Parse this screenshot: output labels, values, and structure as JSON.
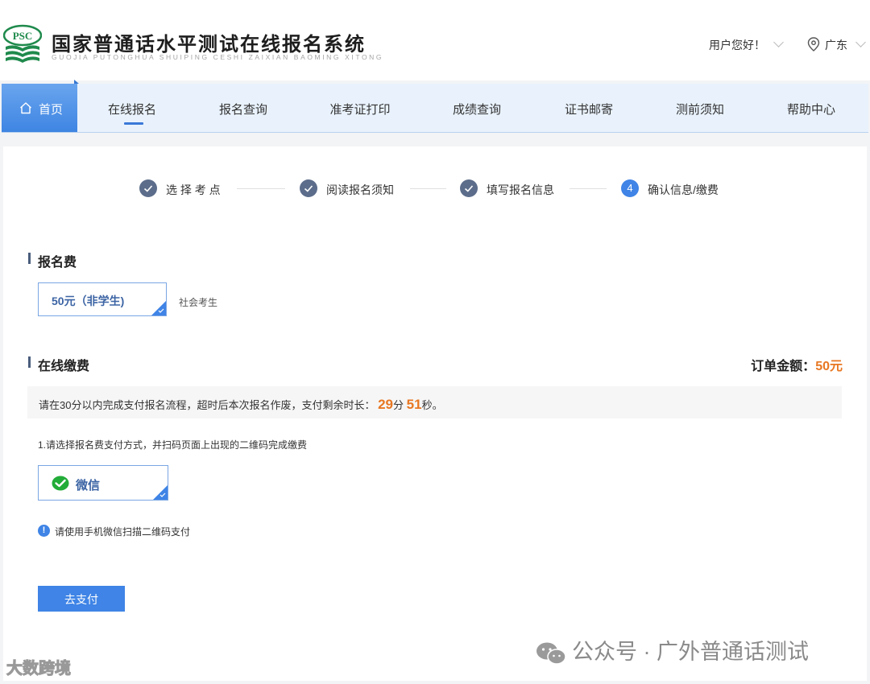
{
  "header": {
    "logo_badge": "PSC",
    "title_cn": "国家普通话水平测试在线报名系统",
    "title_en": "GUOJIA PUTONGHUA SHUIPING CESHI ZAIXIAN BAOMING XITONG",
    "greeting": "用户您好！",
    "region": "广东"
  },
  "nav": {
    "home": "首页",
    "items": [
      "在线报名",
      "报名查询",
      "准考证打印",
      "成绩查询",
      "证书邮寄",
      "测前须知",
      "帮助中心"
    ],
    "active_index": 0
  },
  "steps": [
    {
      "label": "选 择 考 点",
      "status": "done"
    },
    {
      "label": "阅读报名须知",
      "status": "done"
    },
    {
      "label": "填写报名信息",
      "status": "done"
    },
    {
      "label": "确认信息/缴费",
      "status": "current",
      "number": "4"
    }
  ],
  "fee_section": {
    "title": "报名费",
    "option_label": "50元（非学生)",
    "option_note": "社会考生"
  },
  "payment_section": {
    "title": "在线缴费",
    "order_label": "订单金额：",
    "order_amount": "50元",
    "timer_prefix": "请在30分以内完成支付报名流程，超时后本次报名作废，支付剩余时长：",
    "minutes": "29",
    "min_unit": "分",
    "seconds": "51",
    "sec_unit": "秒。",
    "method_hint": "1.请选择报名费支付方式，并扫码页面上出现的二维码完成缴费",
    "method_label": "微信",
    "info_text": "请使用手机微信扫描二维码支付",
    "pay_button": "去支付"
  },
  "watermarks": {
    "right": "公众号 · 广外普通话测试",
    "left": "大数跨境"
  },
  "colors": {
    "accent": "#3f84e6",
    "orange": "#e87722",
    "step_done": "#5c6d8b",
    "nav_bg": "#e9f2fc"
  }
}
